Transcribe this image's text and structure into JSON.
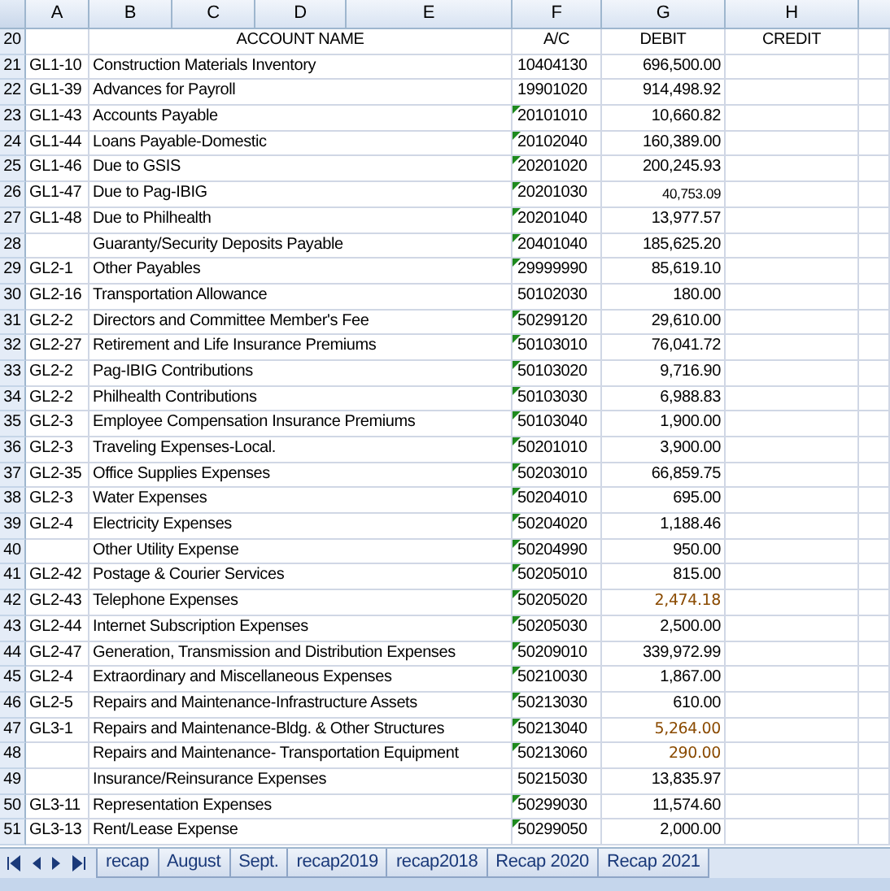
{
  "columns": [
    "A",
    "B",
    "C",
    "D",
    "E",
    "F",
    "G",
    "H"
  ],
  "header_row": {
    "number": "20",
    "account_name": "ACCOUNT NAME",
    "ac": "A/C",
    "debit": "DEBIT",
    "credit": "CREDIT"
  },
  "rows": [
    {
      "number": "21",
      "code": "GL1-10",
      "name": "Construction Materials Inventory",
      "ac": "10404130",
      "text_flag": false,
      "debit": "696,500.00",
      "kind": "plain"
    },
    {
      "number": "22",
      "code": "GL1-39",
      "name": "Advances for Payroll",
      "ac": "19901020",
      "text_flag": false,
      "debit": "914,498.92",
      "kind": "plain"
    },
    {
      "number": "23",
      "code": "GL1-43",
      "name": "Accounts Payable",
      "ac": "20101010",
      "text_flag": true,
      "debit": "10,660.82",
      "kind": "plain"
    },
    {
      "number": "24",
      "code": "GL1-44",
      "name": "Loans Payable-Domestic",
      "ac": "20102040",
      "text_flag": true,
      "debit": "160,389.00",
      "kind": "plain"
    },
    {
      "number": "25",
      "code": "GL1-46",
      "name": "Due to GSIS",
      "ac": "20201020",
      "text_flag": true,
      "debit": "200,245.93",
      "kind": "plain"
    },
    {
      "number": "26",
      "code": "GL1-47",
      "name": "Due to Pag-IBIG",
      "ac": "20201030",
      "text_flag": true,
      "debit": "40,753.09",
      "kind": "small"
    },
    {
      "number": "27",
      "code": "GL1-48",
      "name": "Due to Philhealth",
      "ac": "20201040",
      "text_flag": true,
      "debit": "13,977.57",
      "kind": "plain"
    },
    {
      "number": "28",
      "code": "",
      "name": "Guaranty/Security Deposits Payable",
      "ac": "20401040",
      "text_flag": true,
      "debit": "185,625.20",
      "kind": "plain"
    },
    {
      "number": "29",
      "code": "GL2-1",
      "name": "Other Payables",
      "ac": "29999990",
      "text_flag": true,
      "debit": "85,619.10",
      "kind": "plain"
    },
    {
      "number": "30",
      "code": "GL2-16",
      "name": "Transportation Allowance",
      "ac": "50102030",
      "text_flag": false,
      "debit": "180.00",
      "kind": "plain"
    },
    {
      "number": "31",
      "code": "GL2-2",
      "name": "Directors and Committee Member's Fee",
      "ac": "50299120",
      "text_flag": true,
      "debit": "29,610.00",
      "kind": "plain"
    },
    {
      "number": "32",
      "code": "GL2-27",
      "name": "Retirement and Life Insurance Premiums",
      "ac": "50103010",
      "text_flag": true,
      "debit": "76,041.72",
      "kind": "plain"
    },
    {
      "number": "33",
      "code": "GL2-2",
      "name": "Pag-IBIG Contributions",
      "ac": "50103020",
      "text_flag": true,
      "debit": "9,716.90",
      "kind": "plain"
    },
    {
      "number": "34",
      "code": "GL2-2",
      "name": "Philhealth Contributions",
      "ac": "50103030",
      "text_flag": true,
      "debit": "6,988.83",
      "kind": "plain"
    },
    {
      "number": "35",
      "code": "GL2-3",
      "name": "Employee Compensation Insurance Premiums",
      "ac": "50103040",
      "text_flag": true,
      "debit": "1,900.00",
      "kind": "plain"
    },
    {
      "number": "36",
      "code": "GL2-3",
      "name": "Traveling Expenses-Local.",
      "ac": "50201010",
      "text_flag": true,
      "debit": "3,900.00",
      "kind": "plain"
    },
    {
      "number": "37",
      "code": "GL2-35",
      "name": "Office Supplies Expenses",
      "ac": "50203010",
      "text_flag": true,
      "debit": "66,859.75",
      "kind": "plain"
    },
    {
      "number": "38",
      "code": "GL2-3",
      "name": "Water Expenses",
      "ac": "50204010",
      "text_flag": true,
      "debit": "695.00",
      "kind": "plain"
    },
    {
      "number": "39",
      "code": "GL2-4",
      "name": "Electricity Expenses",
      "ac": "50204020",
      "text_flag": true,
      "debit": "1,188.46",
      "kind": "plain"
    },
    {
      "number": "40",
      "code": "",
      "name": "Other Utility Expense",
      "ac": "50204990",
      "text_flag": true,
      "debit": "950.00",
      "kind": "plain"
    },
    {
      "number": "41",
      "code": "GL2-42",
      "name": "Postage & Courier Services",
      "ac": "50205010",
      "text_flag": true,
      "debit": "815.00",
      "kind": "plain"
    },
    {
      "number": "42",
      "code": "GL2-43",
      "name": "Telephone Expenses",
      "ac": "50205020",
      "text_flag": true,
      "debit": "2,474.18",
      "kind": "accent"
    },
    {
      "number": "43",
      "code": "GL2-44",
      "name": "Internet Subscription Expenses",
      "ac": "50205030",
      "text_flag": true,
      "debit": "2,500.00",
      "kind": "plain"
    },
    {
      "number": "44",
      "code": "GL2-47",
      "name": "Generation, Transmission and Distribution Expenses",
      "ac": "50209010",
      "text_flag": true,
      "debit": "339,972.99",
      "kind": "plain"
    },
    {
      "number": "45",
      "code": "GL2-4",
      "name": "Extraordinary and Miscellaneous Expenses",
      "ac": "50210030",
      "text_flag": true,
      "debit": "1,867.00",
      "kind": "plain"
    },
    {
      "number": "46",
      "code": "GL2-5",
      "name": "Repairs and Maintenance-Infrastructure Assets",
      "ac": "50213030",
      "text_flag": true,
      "debit": "610.00",
      "kind": "plain"
    },
    {
      "number": "47",
      "code": "GL3-1",
      "name": "Repairs and Maintenance-Bldg. & Other Structures",
      "ac": "50213040",
      "text_flag": true,
      "debit": "5,264.00",
      "kind": "accent"
    },
    {
      "number": "48",
      "code": "",
      "name": "Repairs and Maintenance- Transportation Equipment",
      "ac": "50213060",
      "text_flag": true,
      "debit": "290.00",
      "kind": "accent"
    },
    {
      "number": "49",
      "code": "",
      "name": "Insurance/Reinsurance Expenses",
      "ac": "50215030",
      "text_flag": false,
      "debit": "13,835.97",
      "kind": "plain"
    },
    {
      "number": "50",
      "code": "GL3-11",
      "name": "Representation Expenses",
      "ac": "50299030",
      "text_flag": true,
      "debit": "11,574.60",
      "kind": "plain"
    },
    {
      "number": "51",
      "code": "GL3-13",
      "name": "Rent/Lease Expense",
      "ac": "50299050",
      "text_flag": true,
      "debit": "2,000.00",
      "kind": "plain"
    }
  ],
  "sheet_tabs": [
    {
      "label": "recap",
      "selected": false
    },
    {
      "label": "August",
      "selected": false
    },
    {
      "label": "Sept.",
      "selected": false
    },
    {
      "label": "recap2019",
      "selected": false
    },
    {
      "label": "recap2018",
      "selected": false
    },
    {
      "label": "Recap 2020",
      "selected": false
    },
    {
      "label": "Recap 2021",
      "selected": false
    }
  ]
}
